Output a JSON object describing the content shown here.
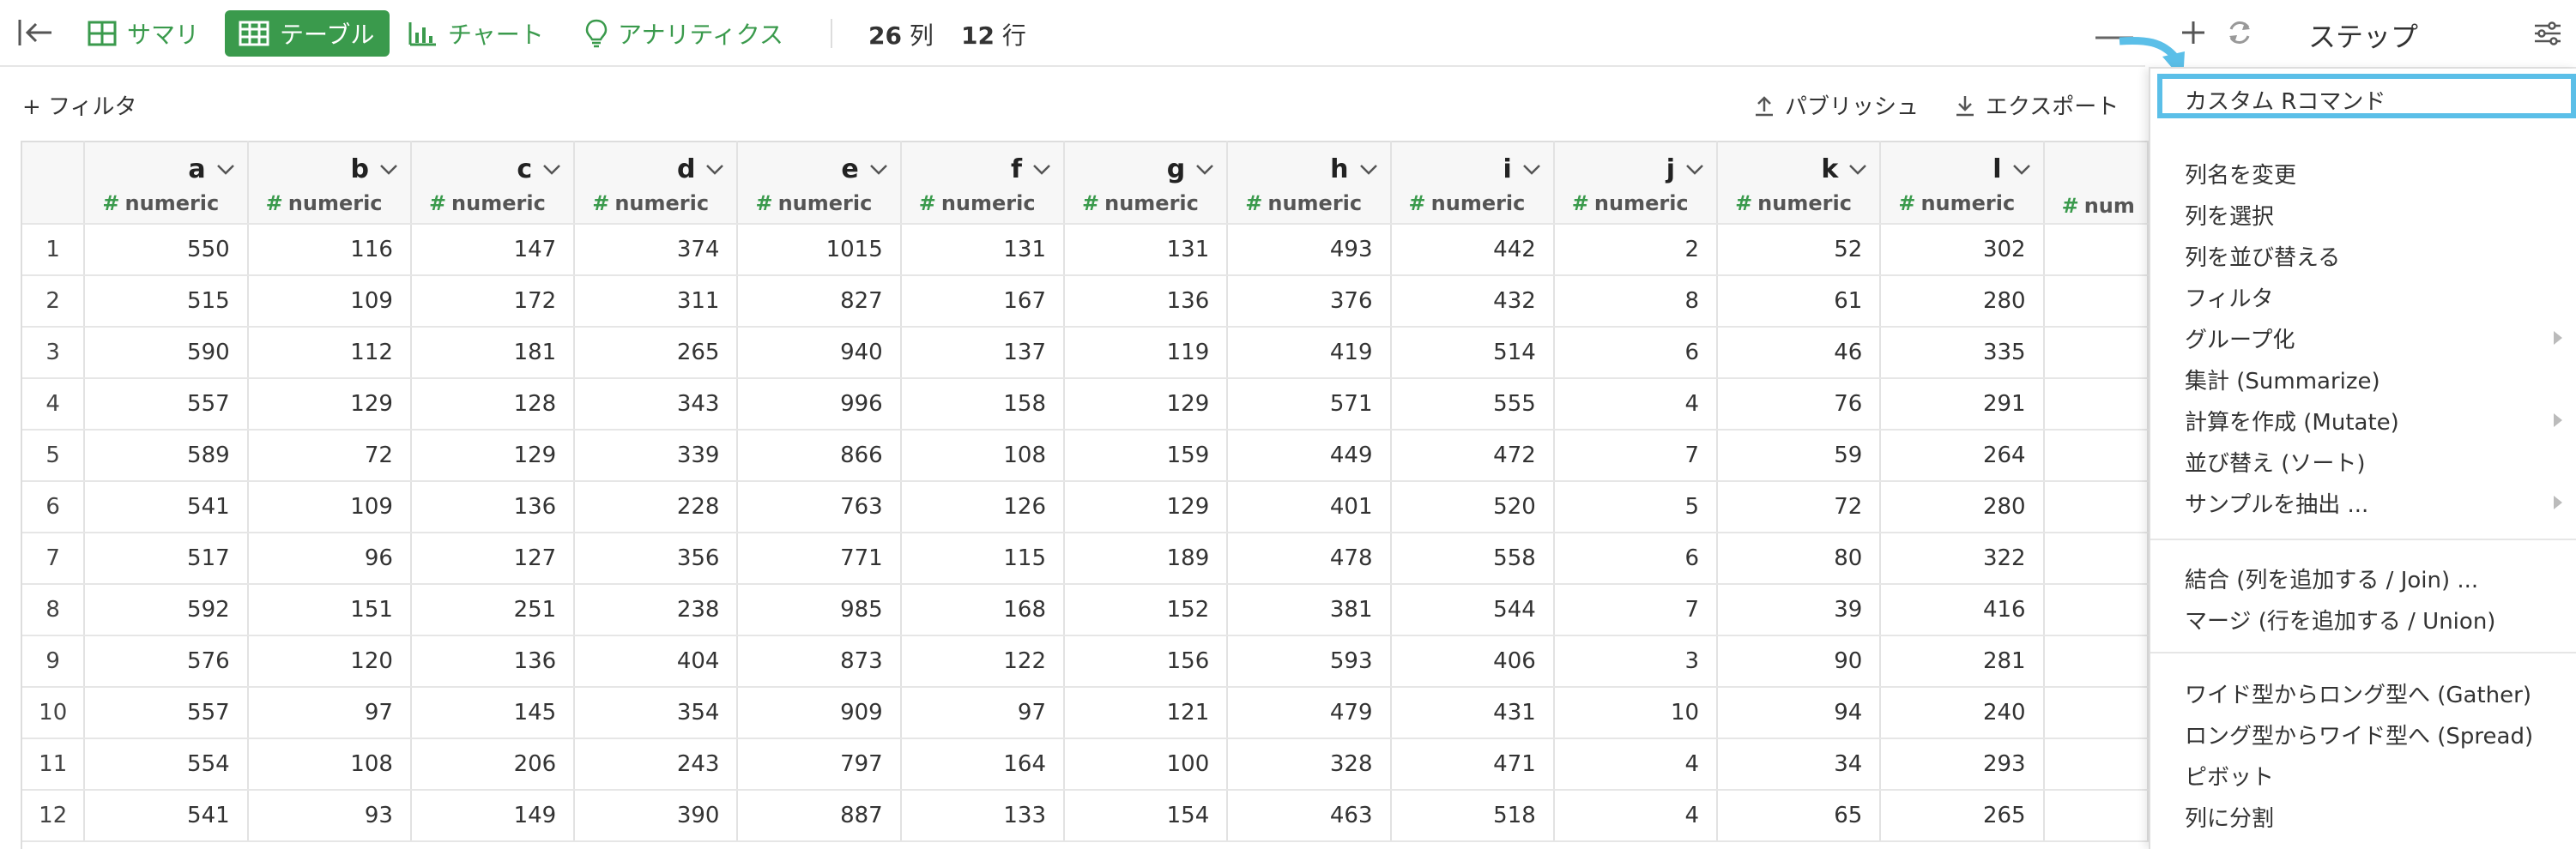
{
  "toolbar": {
    "tabs": [
      "サマリ",
      "テーブル",
      "チャート",
      "アナリティクス"
    ],
    "col_count": "26",
    "col_unit": "列",
    "row_count": "12",
    "row_unit": "行"
  },
  "subbar": {
    "filter_label": "+ フィルタ",
    "publish_label": "パブリッシュ",
    "export_label": "エクスポート"
  },
  "table": {
    "col_type": "numeric",
    "columns": [
      "a",
      "b",
      "c",
      "d",
      "e",
      "f",
      "g",
      "h",
      "i",
      "j",
      "k",
      "l"
    ],
    "partial_col_type": "num",
    "rows": [
      [
        "1",
        "550",
        "116",
        "147",
        "374",
        "1015",
        "131",
        "131",
        "493",
        "442",
        "2",
        "52",
        "302"
      ],
      [
        "2",
        "515",
        "109",
        "172",
        "311",
        "827",
        "167",
        "136",
        "376",
        "432",
        "8",
        "61",
        "280"
      ],
      [
        "3",
        "590",
        "112",
        "181",
        "265",
        "940",
        "137",
        "119",
        "419",
        "514",
        "6",
        "46",
        "335"
      ],
      [
        "4",
        "557",
        "129",
        "128",
        "343",
        "996",
        "158",
        "129",
        "571",
        "555",
        "4",
        "76",
        "291"
      ],
      [
        "5",
        "589",
        "72",
        "129",
        "339",
        "866",
        "108",
        "159",
        "449",
        "472",
        "7",
        "59",
        "264"
      ],
      [
        "6",
        "541",
        "109",
        "136",
        "228",
        "763",
        "126",
        "129",
        "401",
        "520",
        "5",
        "72",
        "280"
      ],
      [
        "7",
        "517",
        "96",
        "127",
        "356",
        "771",
        "115",
        "189",
        "478",
        "558",
        "6",
        "80",
        "322"
      ],
      [
        "8",
        "592",
        "151",
        "251",
        "238",
        "985",
        "168",
        "152",
        "381",
        "544",
        "7",
        "39",
        "416"
      ],
      [
        "9",
        "576",
        "120",
        "136",
        "404",
        "873",
        "122",
        "156",
        "593",
        "406",
        "3",
        "90",
        "281"
      ],
      [
        "10",
        "557",
        "97",
        "145",
        "354",
        "909",
        "97",
        "121",
        "479",
        "431",
        "10",
        "94",
        "240"
      ],
      [
        "11",
        "554",
        "108",
        "206",
        "243",
        "797",
        "164",
        "100",
        "328",
        "471",
        "4",
        "34",
        "293"
      ],
      [
        "12",
        "541",
        "93",
        "149",
        "390",
        "887",
        "133",
        "154",
        "463",
        "518",
        "4",
        "65",
        "265"
      ]
    ]
  },
  "panel": {
    "title": "ステップ",
    "menu": {
      "custom_r": "カスタム Rコマンド",
      "group1": [
        "列名を変更",
        "列を選択",
        "列を並び替える",
        "フィルタ",
        "グループ化",
        "集計 (Summarize)",
        "計算を作成 (Mutate)",
        "並び替え (ソート)",
        "サンプルを抽出 ..."
      ],
      "group2": [
        "結合 (列を追加する / Join) ...",
        "マージ (行を追加する / Union)"
      ],
      "group3": [
        "ワイド型からロング型へ (Gather)",
        "ロング型からワイド型へ (Spread)",
        "ピボット",
        "列に分割"
      ]
    }
  },
  "colors": {
    "accent_green": "#3a9a4c",
    "highlight_blue": "#5bbfe8"
  }
}
